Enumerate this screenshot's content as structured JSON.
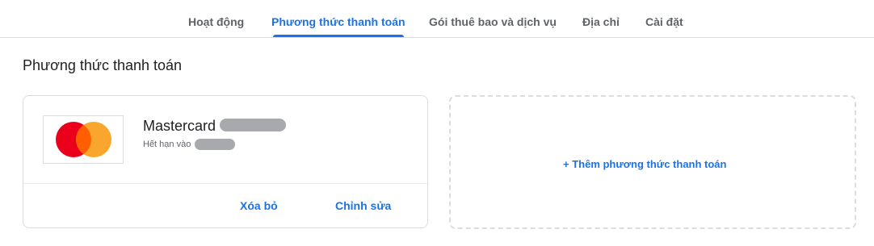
{
  "tabs": [
    {
      "label": "Hoạt động"
    },
    {
      "label": "Phương thức thanh toán"
    },
    {
      "label": "Gói thuê bao và dịch vụ"
    },
    {
      "label": "Địa chỉ"
    },
    {
      "label": "Cài đặt"
    }
  ],
  "active_tab": "Phương thức thanh toán",
  "section": {
    "title": "Phương thức thanh toán"
  },
  "card": {
    "brand": "Mastercard",
    "expiry_label": "Hết hạn vào",
    "logo_icon": "mastercard-logo",
    "actions": {
      "delete": "Xóa bỏ",
      "edit": "Chỉnh sửa"
    }
  },
  "add_method": {
    "label": "+ Thêm phương thức thanh toán"
  },
  "colors": {
    "accent": "#1a73e8",
    "mastercard_red": "#eb001b",
    "mastercard_orange": "#f79e1b",
    "redaction": "#a8a9ac"
  }
}
